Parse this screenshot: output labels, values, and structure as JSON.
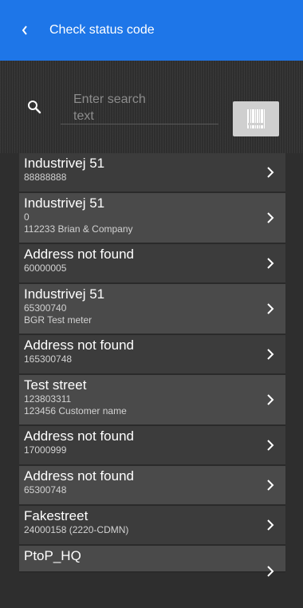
{
  "header": {
    "back_icon": "chevron-left-icon",
    "title": "Check status code"
  },
  "search": {
    "icon": "search-icon",
    "placeholder": "Enter search text",
    "placeholder_line1": "Enter search",
    "placeholder_line2": "text",
    "value": "",
    "barcode_icon": "barcode-icon"
  },
  "items": [
    {
      "title": "Industrivej 51",
      "line1": "88888888",
      "line2": ""
    },
    {
      "title": "Industrivej 51",
      "line1": "0",
      "line2": "112233 Brian & Company"
    },
    {
      "title": "Address not found",
      "line1": "60000005",
      "line2": ""
    },
    {
      "title": "Industrivej 51",
      "line1": "65300740",
      "line2": "BGR Test meter"
    },
    {
      "title": "Address not found",
      "line1": "165300748",
      "line2": ""
    },
    {
      "title": "Test street",
      "line1": "123803311",
      "line2": "123456 Customer name"
    },
    {
      "title": "Address not found",
      "line1": "17000999",
      "line2": ""
    },
    {
      "title": "Address not found",
      "line1": "65300748",
      "line2": ""
    },
    {
      "title": "Fakestreet",
      "line1": "24000158 (2220-CDMN)",
      "line2": ""
    },
    {
      "title": "PtoP_HQ",
      "line1": "",
      "line2": ""
    }
  ],
  "colors": {
    "app_bar": "#1e76e8",
    "background": "#2e2e2e",
    "row_dark": "#3c3c3c",
    "row_light": "#4a4a4a",
    "text_primary": "#ffffff",
    "text_secondary": "#d2d2d2"
  }
}
